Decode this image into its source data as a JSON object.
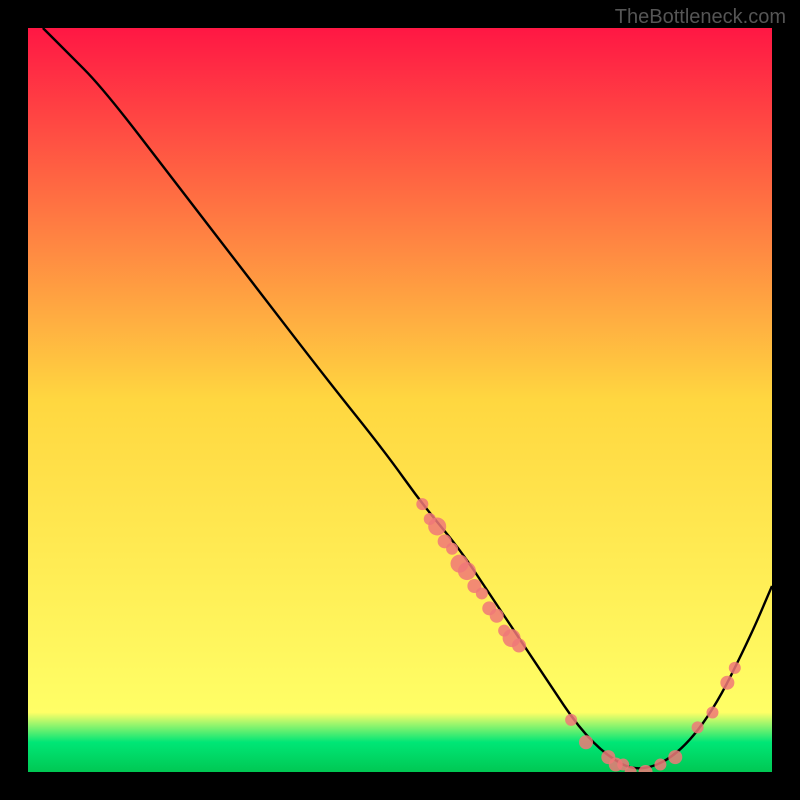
{
  "watermark": "TheBottleneck.com",
  "chart_data": {
    "type": "line",
    "title": "",
    "xlabel": "",
    "ylabel": "",
    "xlim": [
      0,
      100
    ],
    "ylim": [
      0,
      100
    ],
    "gradient_stops": [
      {
        "offset": 0,
        "color": "#ff1744"
      },
      {
        "offset": 50,
        "color": "#ffd740"
      },
      {
        "offset": 92,
        "color": "#ffff66"
      },
      {
        "offset": 96,
        "color": "#00e676"
      },
      {
        "offset": 100,
        "color": "#00c853"
      }
    ],
    "curve": {
      "name": "bottleneck-curve",
      "x": [
        2,
        5,
        10,
        20,
        30,
        40,
        48,
        53,
        58,
        62,
        66,
        70,
        74,
        78,
        82,
        87,
        92,
        97,
        100
      ],
      "y": [
        100,
        97,
        92,
        79,
        66,
        53,
        43,
        36,
        30,
        24,
        18,
        12,
        6,
        2,
        0,
        2,
        8,
        18,
        25
      ]
    },
    "scatter": {
      "name": "markers",
      "points": [
        {
          "x": 53,
          "y": 36,
          "r": 6
        },
        {
          "x": 54,
          "y": 34,
          "r": 6
        },
        {
          "x": 55,
          "y": 33,
          "r": 9
        },
        {
          "x": 56,
          "y": 31,
          "r": 7
        },
        {
          "x": 57,
          "y": 30,
          "r": 6
        },
        {
          "x": 58,
          "y": 28,
          "r": 9
        },
        {
          "x": 59,
          "y": 27,
          "r": 9
        },
        {
          "x": 60,
          "y": 25,
          "r": 7
        },
        {
          "x": 61,
          "y": 24,
          "r": 6
        },
        {
          "x": 62,
          "y": 22,
          "r": 7
        },
        {
          "x": 63,
          "y": 21,
          "r": 7
        },
        {
          "x": 64,
          "y": 19,
          "r": 6
        },
        {
          "x": 65,
          "y": 18,
          "r": 9
        },
        {
          "x": 66,
          "y": 17,
          "r": 7
        },
        {
          "x": 73,
          "y": 7,
          "r": 6
        },
        {
          "x": 75,
          "y": 4,
          "r": 7
        },
        {
          "x": 78,
          "y": 2,
          "r": 7
        },
        {
          "x": 79,
          "y": 1,
          "r": 7
        },
        {
          "x": 80,
          "y": 1,
          "r": 6
        },
        {
          "x": 81,
          "y": 0,
          "r": 6
        },
        {
          "x": 83,
          "y": 0,
          "r": 7
        },
        {
          "x": 85,
          "y": 1,
          "r": 6
        },
        {
          "x": 87,
          "y": 2,
          "r": 7
        },
        {
          "x": 90,
          "y": 6,
          "r": 6
        },
        {
          "x": 92,
          "y": 8,
          "r": 6
        },
        {
          "x": 94,
          "y": 12,
          "r": 7
        },
        {
          "x": 95,
          "y": 14,
          "r": 6
        }
      ],
      "fill": "#f07878",
      "fill_opacity": 0.85
    }
  }
}
